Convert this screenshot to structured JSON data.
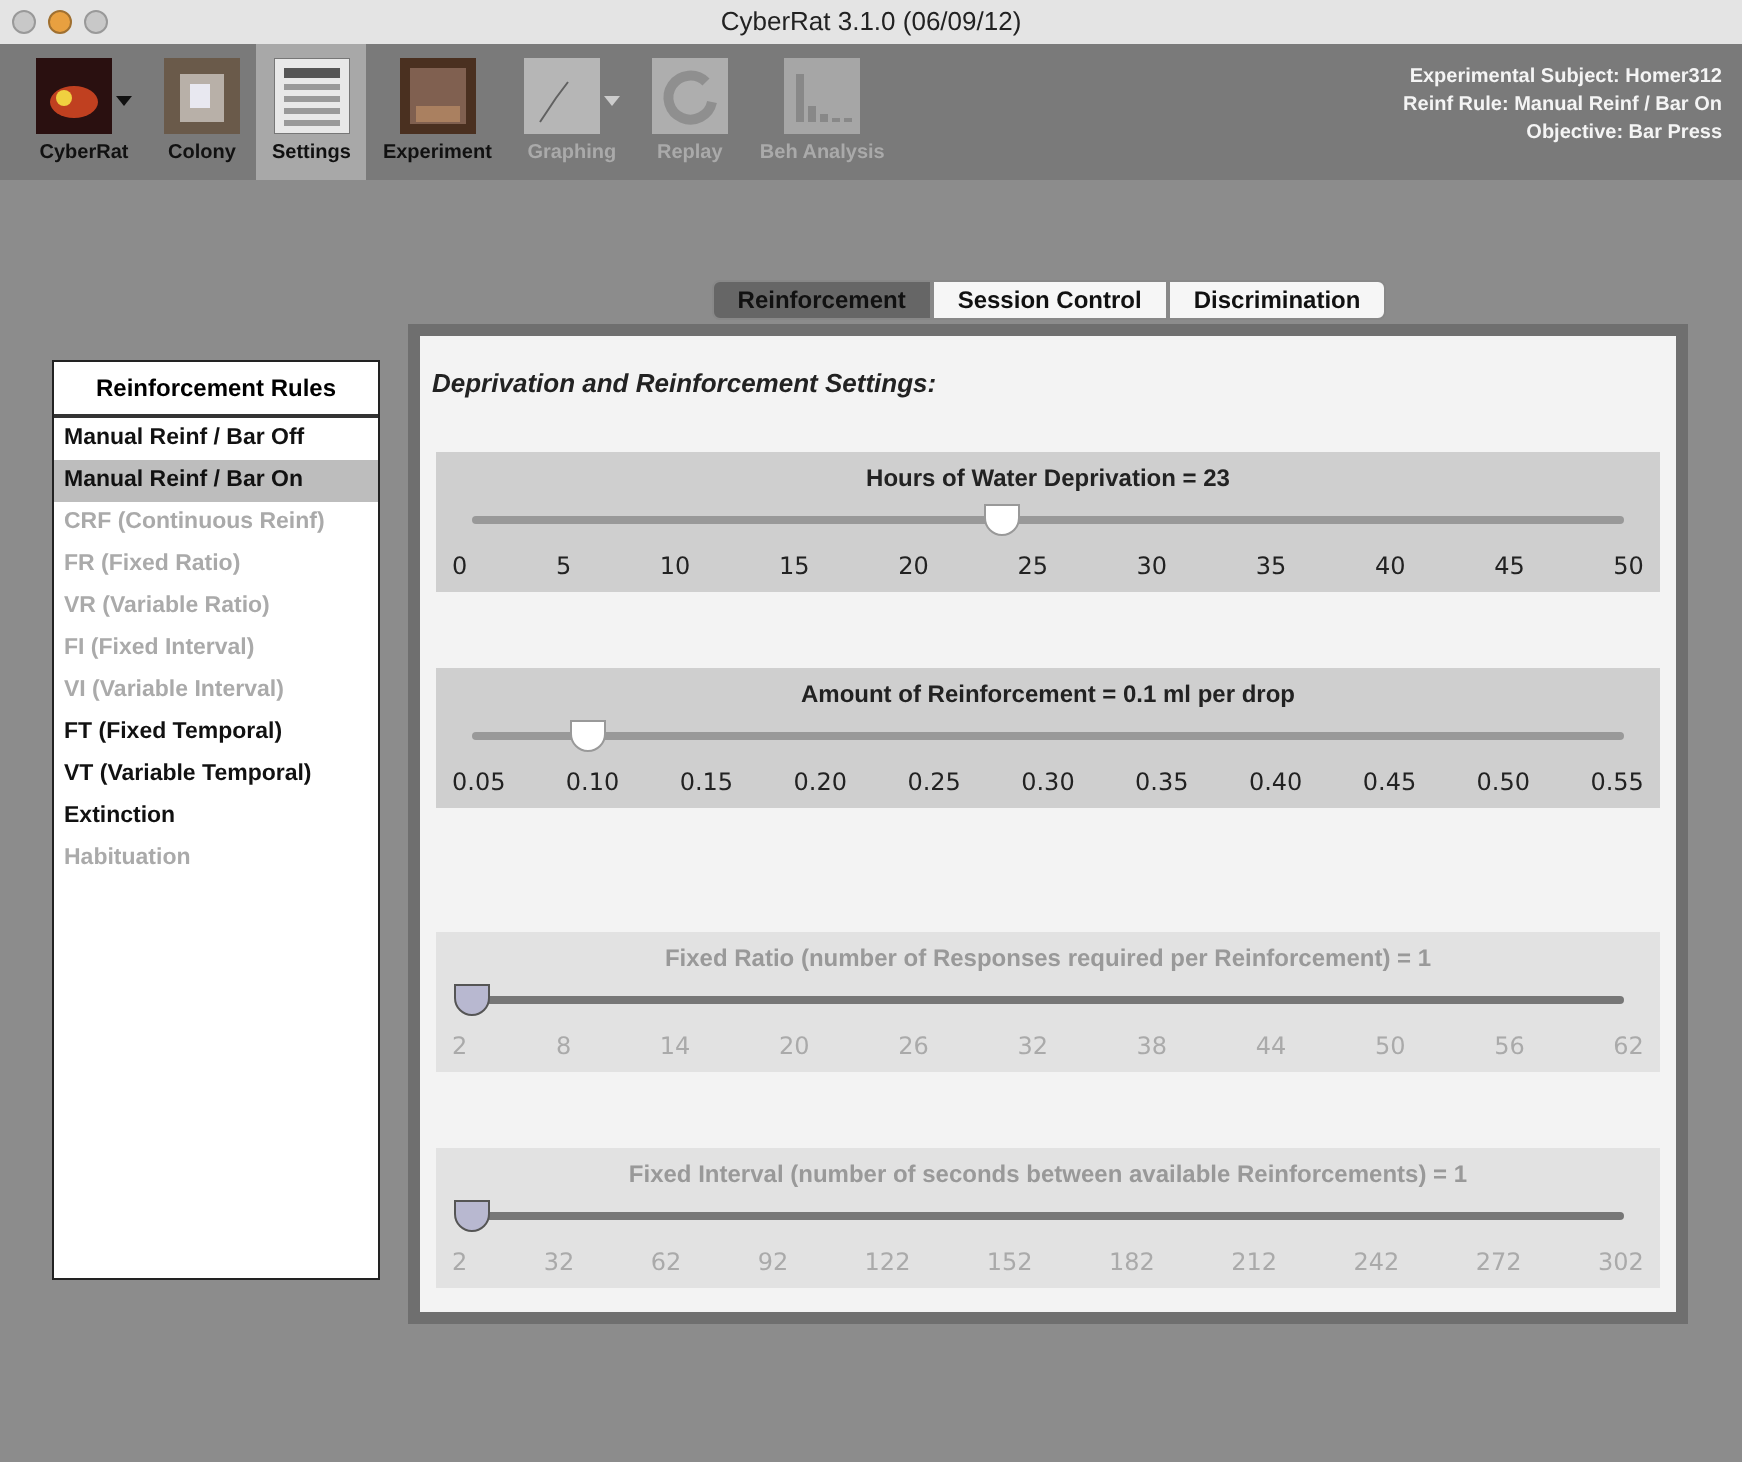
{
  "window": {
    "title": "CyberRat 3.1.0 (06/09/12)"
  },
  "toolbar": [
    {
      "label": "CyberRat",
      "selected": false,
      "disabled": false,
      "dropdown": true
    },
    {
      "label": "Colony",
      "selected": false,
      "disabled": false,
      "dropdown": false
    },
    {
      "label": "Settings",
      "selected": true,
      "disabled": false,
      "dropdown": false
    },
    {
      "label": "Experiment",
      "selected": false,
      "disabled": false,
      "dropdown": false
    },
    {
      "label": "Graphing",
      "selected": false,
      "disabled": true,
      "dropdown": true
    },
    {
      "label": "Replay",
      "selected": false,
      "disabled": true,
      "dropdown": false
    },
    {
      "label": "Beh Analysis",
      "selected": false,
      "disabled": true,
      "dropdown": false
    }
  ],
  "info": [
    "Experimental Subject: Homer312",
    "Reinf Rule: Manual Reinf / Bar On",
    "Objective: Bar Press"
  ],
  "sidebar": {
    "title": "Reinforcement Rules",
    "items": [
      {
        "label": "Manual Reinf / Bar Off",
        "selected": false,
        "disabled": false
      },
      {
        "label": "Manual Reinf / Bar On",
        "selected": true,
        "disabled": false
      },
      {
        "label": "CRF (Continuous Reinf)",
        "selected": false,
        "disabled": true
      },
      {
        "label": "FR (Fixed Ratio)",
        "selected": false,
        "disabled": true
      },
      {
        "label": "VR (Variable Ratio)",
        "selected": false,
        "disabled": true
      },
      {
        "label": "FI (Fixed Interval)",
        "selected": false,
        "disabled": true
      },
      {
        "label": "VI (Variable Interval)",
        "selected": false,
        "disabled": true
      },
      {
        "label": "FT (Fixed Temporal)",
        "selected": false,
        "disabled": false
      },
      {
        "label": "VT (Variable Temporal)",
        "selected": false,
        "disabled": false
      },
      {
        "label": "Extinction",
        "selected": false,
        "disabled": false
      },
      {
        "label": "Habituation",
        "selected": false,
        "disabled": true
      }
    ]
  },
  "tabs": [
    {
      "label": "Reinforcement",
      "selected": true
    },
    {
      "label": "Session Control",
      "selected": false
    },
    {
      "label": "Discrimination",
      "selected": false
    }
  ],
  "panel": {
    "heading": "Deprivation and Reinforcement Settings:",
    "sliders": [
      {
        "label": "Hours of Water Deprivation = 23",
        "level": 0.46,
        "disabled": false,
        "ticks": [
          "0",
          "5",
          "10",
          "15",
          "20",
          "25",
          "30",
          "35",
          "40",
          "45",
          "50"
        ]
      },
      {
        "label": "Amount of Reinforcement  = 0.1 ml per drop",
        "level": 0.1,
        "disabled": false,
        "ticks": [
          "0.05",
          "0.10",
          "0.15",
          "0.20",
          "0.25",
          "0.30",
          "0.35",
          "0.40",
          "0.45",
          "0.50",
          "0.55"
        ]
      },
      {
        "label": "Fixed Ratio (number of Responses required per Reinforcement) = 1",
        "level": 0,
        "disabled": true,
        "ticks": [
          "2",
          "8",
          "14",
          "20",
          "26",
          "32",
          "38",
          "44",
          "50",
          "56",
          "62"
        ]
      },
      {
        "label": "Fixed Interval (number of seconds between available Reinforcements) = 1",
        "level": 0,
        "disabled": true,
        "ticks": [
          "2",
          "32",
          "62",
          "92",
          "122",
          "152",
          "182",
          "212",
          "242",
          "272",
          "302"
        ]
      }
    ]
  }
}
